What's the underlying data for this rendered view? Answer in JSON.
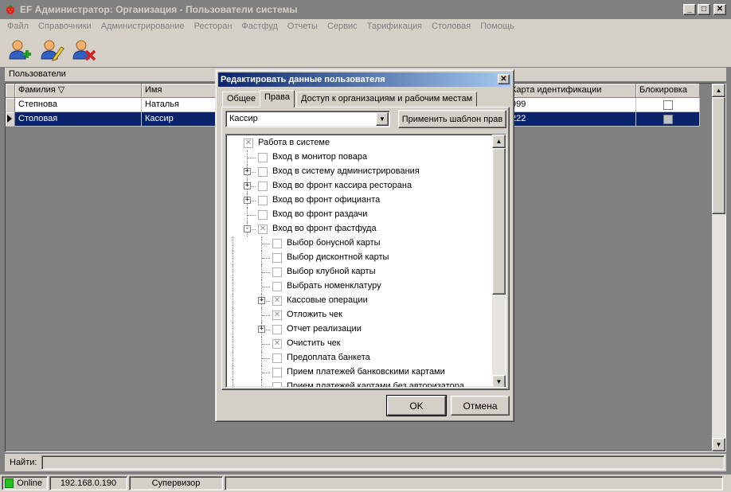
{
  "window": {
    "title": "EF Администратор: Организация - Пользователи системы",
    "buttons": {
      "minimize": "_",
      "maximize": "□",
      "close": "✕"
    }
  },
  "menu": [
    "Файл",
    "Справочники",
    "Администрирование",
    "Ресторан",
    "Фастфуд",
    "Отчеты",
    "Сервис",
    "Тарификация",
    "Столовая",
    "Помощь"
  ],
  "toolbar": [
    "add-user-icon",
    "edit-user-icon",
    "delete-user-icon"
  ],
  "panel": {
    "title": "Пользователи"
  },
  "grid": {
    "columns": [
      "Фамилия ▽",
      "Имя",
      "Карта идентификации",
      "Блокировка"
    ],
    "rows": [
      {
        "last": "Степнова",
        "first": "Наталья",
        "card": "999",
        "selected": false
      },
      {
        "last": "Столовая",
        "first": "Кассир",
        "card": "222",
        "selected": true
      }
    ]
  },
  "find": {
    "label": "Найти:",
    "value": ""
  },
  "status": {
    "connection": "Online",
    "ip": "192.168.0.190",
    "user": "Супервизор"
  },
  "dialog": {
    "title": "Редактировать данные пользователя",
    "close": "✕",
    "tabs": [
      "Общее",
      "Права",
      "Доступ к организациям и рабочим местам"
    ],
    "active_tab": "Права",
    "template_value": "Кассир",
    "apply_button": "Применить шаблон прав",
    "tree": [
      {
        "label": "Работа в системе",
        "level": 0,
        "checked": true,
        "expander": "none"
      },
      {
        "label": "Вход в монитор повара",
        "level": 1,
        "checked": false,
        "expander": "none"
      },
      {
        "label": "Вход в систему администрирования",
        "level": 1,
        "checked": false,
        "expander": "+"
      },
      {
        "label": "Вход во фронт кассира ресторана",
        "level": 1,
        "checked": false,
        "expander": "+"
      },
      {
        "label": "Вход во фронт официанта",
        "level": 1,
        "checked": false,
        "expander": "+"
      },
      {
        "label": "Вход во фронт раздачи",
        "level": 1,
        "checked": false,
        "expander": "none"
      },
      {
        "label": "Вход во фронт фастфуда",
        "level": 1,
        "checked": true,
        "expander": "-"
      },
      {
        "label": "Выбор бонусной карты",
        "level": 2,
        "checked": false,
        "expander": "none"
      },
      {
        "label": "Выбор дисконтной карты",
        "level": 2,
        "checked": false,
        "expander": "none"
      },
      {
        "label": "Выбор клубной карты",
        "level": 2,
        "checked": false,
        "expander": "none"
      },
      {
        "label": "Выбрать номенклатуру",
        "level": 2,
        "checked": false,
        "expander": "none"
      },
      {
        "label": "Кассовые операции",
        "level": 2,
        "checked": true,
        "expander": "+"
      },
      {
        "label": "Отложить чек",
        "level": 2,
        "checked": true,
        "expander": "none"
      },
      {
        "label": "Отчет реализации",
        "level": 2,
        "checked": false,
        "expander": "+"
      },
      {
        "label": "Очистить чек",
        "level": 2,
        "checked": true,
        "expander": "none"
      },
      {
        "label": "Предоплата банкета",
        "level": 2,
        "checked": false,
        "expander": "none"
      },
      {
        "label": "Прием платежей банковскими картами",
        "level": 2,
        "checked": false,
        "expander": "none"
      },
      {
        "label": "Прием платежей картами без авторизатора",
        "level": 2,
        "checked": false,
        "expander": "none"
      }
    ],
    "ok_button": "OK",
    "cancel_button": "Отмена"
  },
  "colors": {
    "selection": "#0a246a",
    "dialog_title_start": "#0a246a",
    "dialog_title_end": "#a6caf0",
    "face": "#d4d0c8",
    "workspace": "#808080"
  }
}
